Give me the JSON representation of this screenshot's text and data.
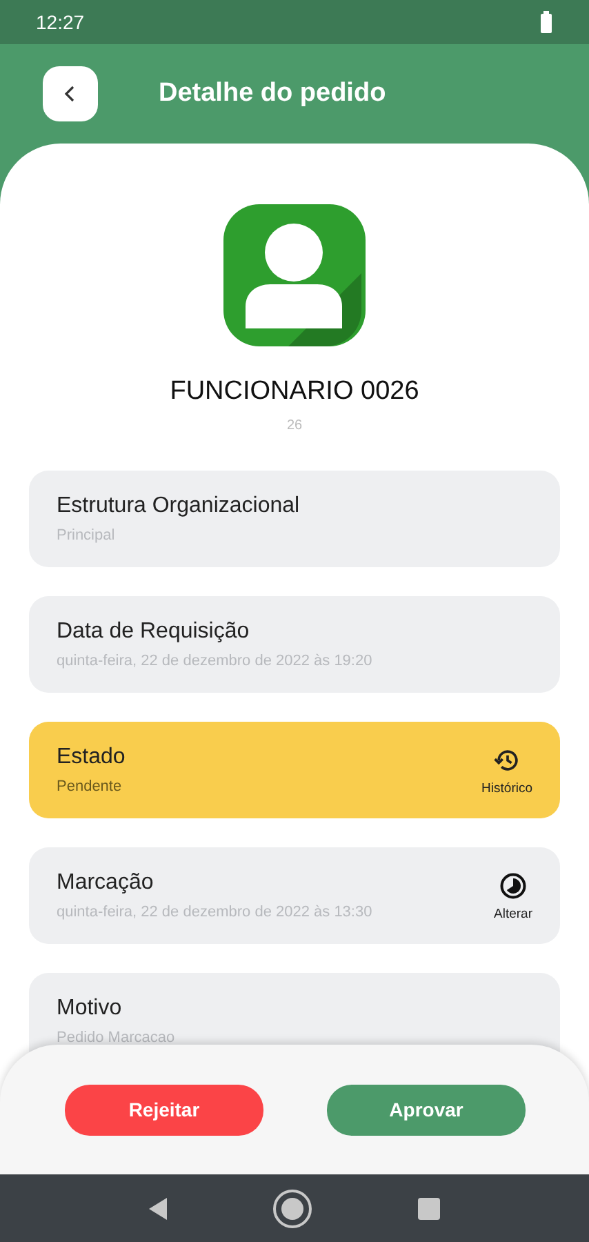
{
  "status_bar": {
    "time": "12:27"
  },
  "header": {
    "title": "Detalhe do pedido"
  },
  "employee": {
    "name": "FUNCIONARIO 0026",
    "number": "26"
  },
  "cards": [
    {
      "kind": "info",
      "title": "Estrutura Organizacional",
      "value": "Principal"
    },
    {
      "kind": "info",
      "title": "Data de Requisição",
      "value": "quinta-feira, 22 de dezembro de 2022 às 19:20"
    },
    {
      "kind": "status",
      "title": "Estado",
      "value": "Pendente",
      "action": {
        "kind": "history",
        "label": "Histórico"
      }
    },
    {
      "kind": "info",
      "title": "Marcação",
      "value": "quinta-feira, 22 de dezembro de 2022 às 13:30",
      "action": {
        "kind": "change",
        "label": "Alterar"
      }
    },
    {
      "kind": "info",
      "title": "Motivo",
      "value": "Pedido Marcacao"
    }
  ],
  "actions": [
    {
      "kind": "reject",
      "label": "Rejeitar"
    },
    {
      "kind": "approve",
      "label": "Aprovar"
    }
  ]
}
